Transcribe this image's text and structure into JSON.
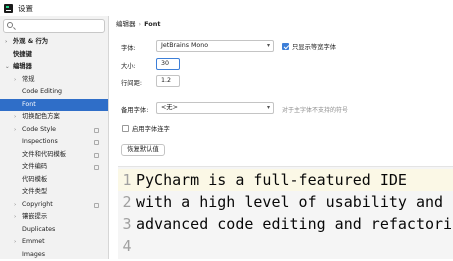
{
  "window": {
    "title": "设置"
  },
  "sidebar": {
    "items": [
      {
        "label": "外观 & 行为",
        "arrow": "›",
        "level": 0,
        "bold": true
      },
      {
        "label": "快捷键",
        "arrow": "",
        "level": 0,
        "bold": true
      },
      {
        "label": "编辑器",
        "arrow": "⌄",
        "level": 0,
        "bold": true
      },
      {
        "label": "常规",
        "arrow": "›",
        "level": 1
      },
      {
        "label": "Code Editing",
        "arrow": "",
        "level": 1
      },
      {
        "label": "Font",
        "arrow": "",
        "level": 1,
        "selected": true
      },
      {
        "label": "切换配色方案",
        "arrow": "›",
        "level": 1
      },
      {
        "label": "Code Style",
        "arrow": "›",
        "level": 1,
        "project": true
      },
      {
        "label": "Inspections",
        "arrow": "",
        "level": 1,
        "project": true
      },
      {
        "label": "文件和代码模板",
        "arrow": "",
        "level": 1,
        "project": true
      },
      {
        "label": "文件编码",
        "arrow": "",
        "level": 1,
        "project": true
      },
      {
        "label": "代码模板",
        "arrow": "",
        "level": 1
      },
      {
        "label": "文件类型",
        "arrow": "",
        "level": 1
      },
      {
        "label": "Copyright",
        "arrow": "›",
        "level": 1,
        "project": true
      },
      {
        "label": "镶嵌提示",
        "arrow": "›",
        "level": 1
      },
      {
        "label": "Duplicates",
        "arrow": "",
        "level": 1
      },
      {
        "label": "Emmet",
        "arrow": "›",
        "level": 1
      },
      {
        "label": "Images",
        "arrow": "",
        "level": 1
      }
    ]
  },
  "breadcrumb": {
    "parent": "编辑器",
    "separator": "›",
    "current": "Font"
  },
  "form": {
    "font_label": "字体:",
    "font_value": "JetBrains Mono",
    "monospace_only_label": "只显示等宽字体",
    "monospace_only_checked": true,
    "size_label": "大小:",
    "size_value": "30",
    "line_height_label": "行间距:",
    "line_height_value": "1.2",
    "fallback_label": "备用字体:",
    "fallback_value": "<无>",
    "fallback_hint": "对于主字体不支持的符号",
    "ligatures_label": "启用字体连字",
    "ligatures_checked": false,
    "restore_button": "恢复默认值"
  },
  "preview": {
    "lines": [
      {
        "num": "1",
        "text": "PyCharm is a full-featured IDE"
      },
      {
        "num": "2",
        "text": "with a high level of usability and"
      },
      {
        "num": "3",
        "text": "advanced code editing and refactori"
      },
      {
        "num": "4",
        "text": ""
      }
    ]
  },
  "colors": {
    "accent": "#2f6ec8",
    "focus": "#3d7fd8"
  }
}
